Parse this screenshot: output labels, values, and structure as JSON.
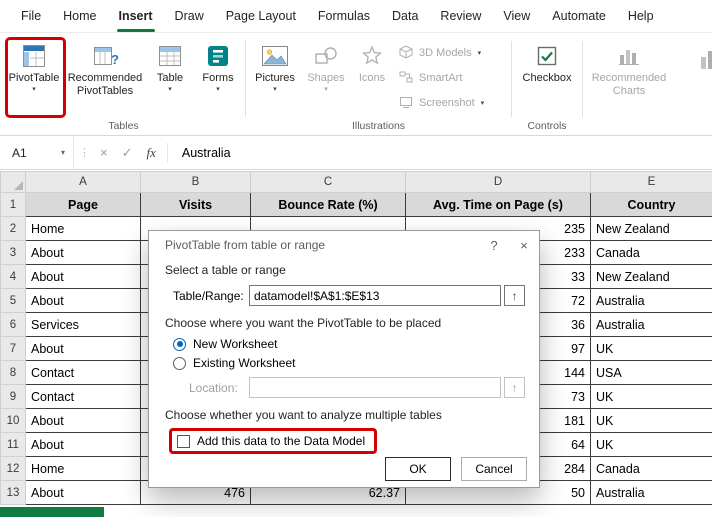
{
  "ribbon": {
    "tabs": [
      "File",
      "Home",
      "Insert",
      "Draw",
      "Page Layout",
      "Formulas",
      "Data",
      "Review",
      "View",
      "Automate",
      "Help"
    ],
    "active_tab": "Insert",
    "tables_group": {
      "label": "Tables",
      "pivottable": "PivotTable",
      "recommended_pivottables": "Recommended PivotTables",
      "table": "Table",
      "forms": "Forms"
    },
    "illustrations_group": {
      "label": "Illustrations",
      "pictures": "Pictures",
      "shapes": "Shapes",
      "icons": "Icons",
      "models_3d": "3D Models",
      "smartart": "SmartArt",
      "screenshot": "Screenshot"
    },
    "controls_group": {
      "label": "Controls",
      "checkbox": "Checkbox"
    },
    "charts_group": {
      "recommended_charts": "Recommended Charts"
    }
  },
  "formula_bar": {
    "name_box": "A1",
    "value": "Australia"
  },
  "icons": {
    "dropdown_caret": "▾",
    "splitter_dots": "⋮",
    "formula_cancel": "×",
    "formula_confirm": "✓",
    "formula_fx": "fx",
    "dialog_help": "?",
    "dialog_close": "×",
    "range_selector": "↑"
  },
  "grid": {
    "column_letters": [
      "A",
      "B",
      "C",
      "D",
      "E"
    ],
    "rows": [
      {
        "num": "1",
        "header": true,
        "cells": [
          "Page",
          "Visits",
          "Bounce Rate (%)",
          "Avg. Time on Page (s)",
          "Country"
        ]
      },
      {
        "num": "2",
        "cells": [
          "Home",
          "",
          "",
          "235",
          "New Zealand"
        ]
      },
      {
        "num": "3",
        "cells": [
          "About",
          "",
          "",
          "233",
          "Canada"
        ]
      },
      {
        "num": "4",
        "cells": [
          "About",
          "",
          "",
          "33",
          "New Zealand"
        ]
      },
      {
        "num": "5",
        "cells": [
          "About",
          "",
          "",
          "72",
          "Australia"
        ]
      },
      {
        "num": "6",
        "cells": [
          "Services",
          "",
          "",
          "36",
          "Australia"
        ]
      },
      {
        "num": "7",
        "cells": [
          "About",
          "",
          "",
          "97",
          "UK"
        ]
      },
      {
        "num": "8",
        "cells": [
          "Contact",
          "",
          "",
          "144",
          "USA"
        ]
      },
      {
        "num": "9",
        "cells": [
          "Contact",
          "",
          "",
          "73",
          "UK"
        ]
      },
      {
        "num": "10",
        "cells": [
          "About",
          "",
          "",
          "181",
          "UK"
        ]
      },
      {
        "num": "11",
        "cells": [
          "About",
          "",
          "",
          "64",
          "UK"
        ]
      },
      {
        "num": "12",
        "cells": [
          "Home",
          "",
          "",
          "284",
          "Canada"
        ]
      },
      {
        "num": "13",
        "cells": [
          "About",
          "476",
          "62.37",
          "50",
          "Australia"
        ]
      }
    ]
  },
  "dialog": {
    "title": "PivotTable from table or range",
    "select_range_heading": "Select a table or range",
    "table_range_label": "Table/Range:",
    "table_range_value": "datamodel!$A$1:$E$13",
    "placement_heading": "Choose where you want the PivotTable to be placed",
    "new_worksheet_label": "New Worksheet",
    "existing_worksheet_label": "Existing Worksheet",
    "location_label": "Location:",
    "location_value": "",
    "multiple_tables_heading": "Choose whether you want to analyze multiple tables",
    "data_model_checkbox_label": "Add this data to the Data Model",
    "ok_label": "OK",
    "cancel_label": "Cancel"
  },
  "colors": {
    "excel_green": "#107C41",
    "accent_blue": "#0067C0",
    "highlight_red": "#D40000"
  }
}
